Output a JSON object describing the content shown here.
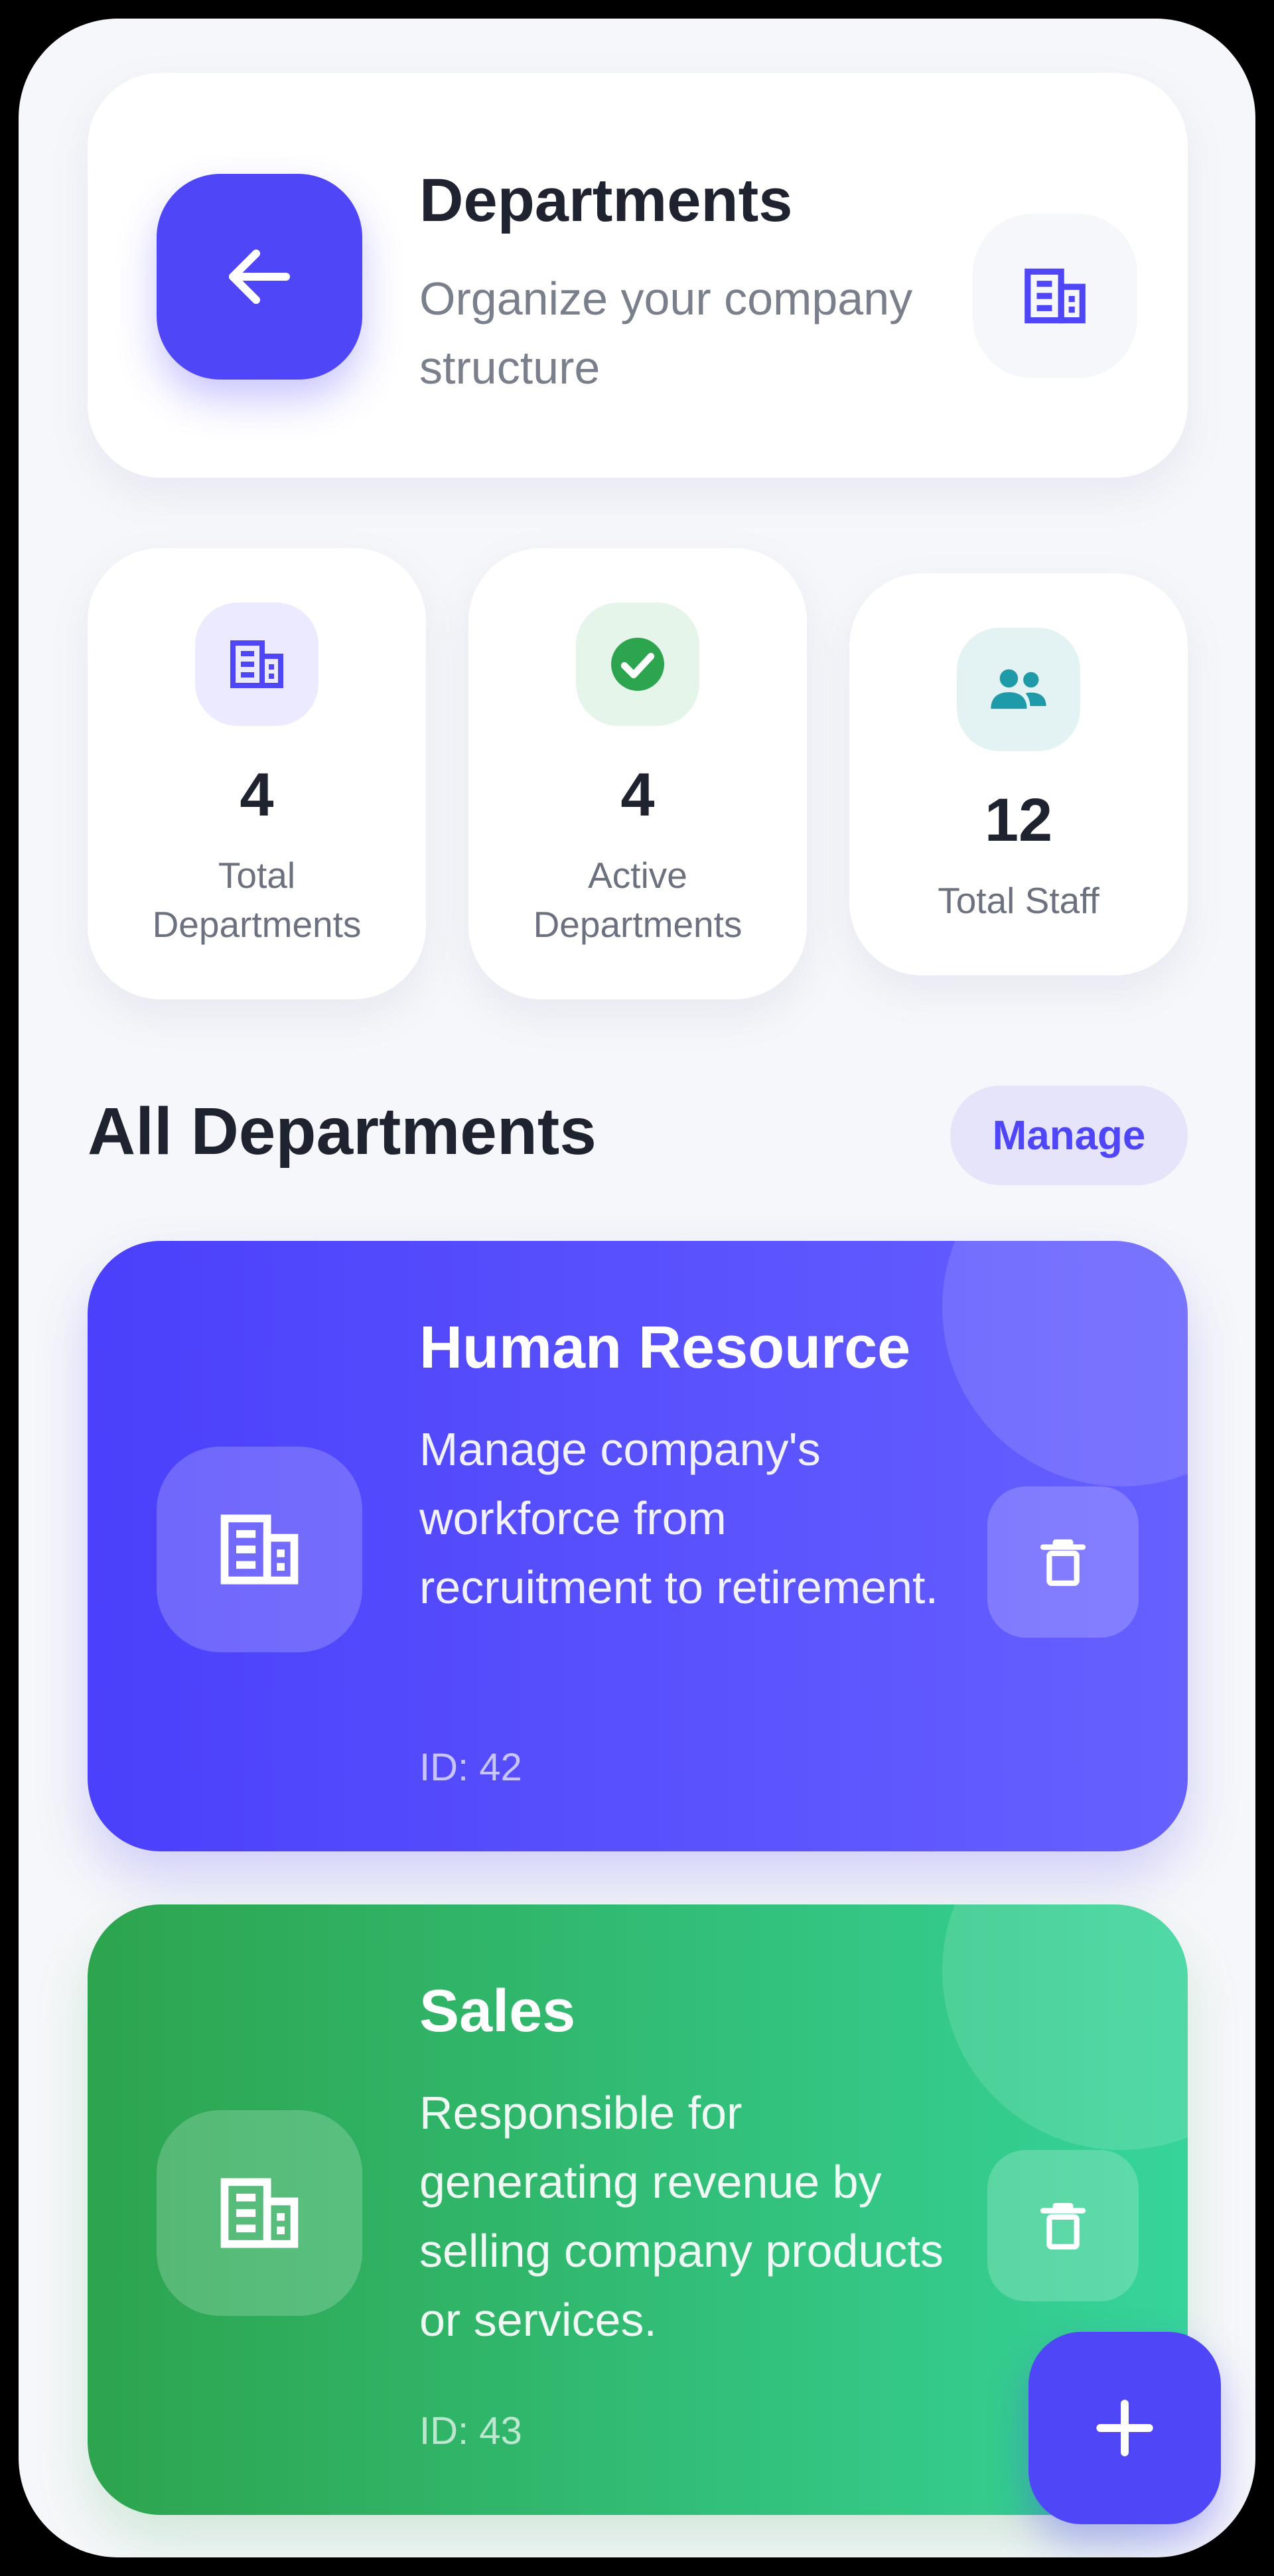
{
  "colors": {
    "primary": "#4f46f8",
    "success": "#2da44e",
    "teal": "#1f9aa8"
  },
  "header": {
    "title": "Departments",
    "subtitle": "Organize your company structure",
    "back_icon": "arrow-left-icon",
    "side_icon": "building-icon"
  },
  "stats": [
    {
      "value": "4",
      "label": "Total Departments",
      "icon": "building-icon"
    },
    {
      "value": "4",
      "label": "Active Departments",
      "icon": "check-circle-icon"
    },
    {
      "value": "12",
      "label": "Total Staff",
      "icon": "people-icon"
    }
  ],
  "section": {
    "title": "All Departments",
    "manage_label": "Manage"
  },
  "departments": [
    {
      "name": "Human Resource",
      "description": "Manage company's workforce from recruitment to retirement.",
      "id_label": "ID: 42",
      "color": "#4f46f8"
    },
    {
      "name": "Sales",
      "description": "Responsible for generating revenue by selling company products or services.",
      "id_label": "ID: 43",
      "color": "#2da44e"
    }
  ],
  "fab": {
    "icon": "plus-icon"
  }
}
